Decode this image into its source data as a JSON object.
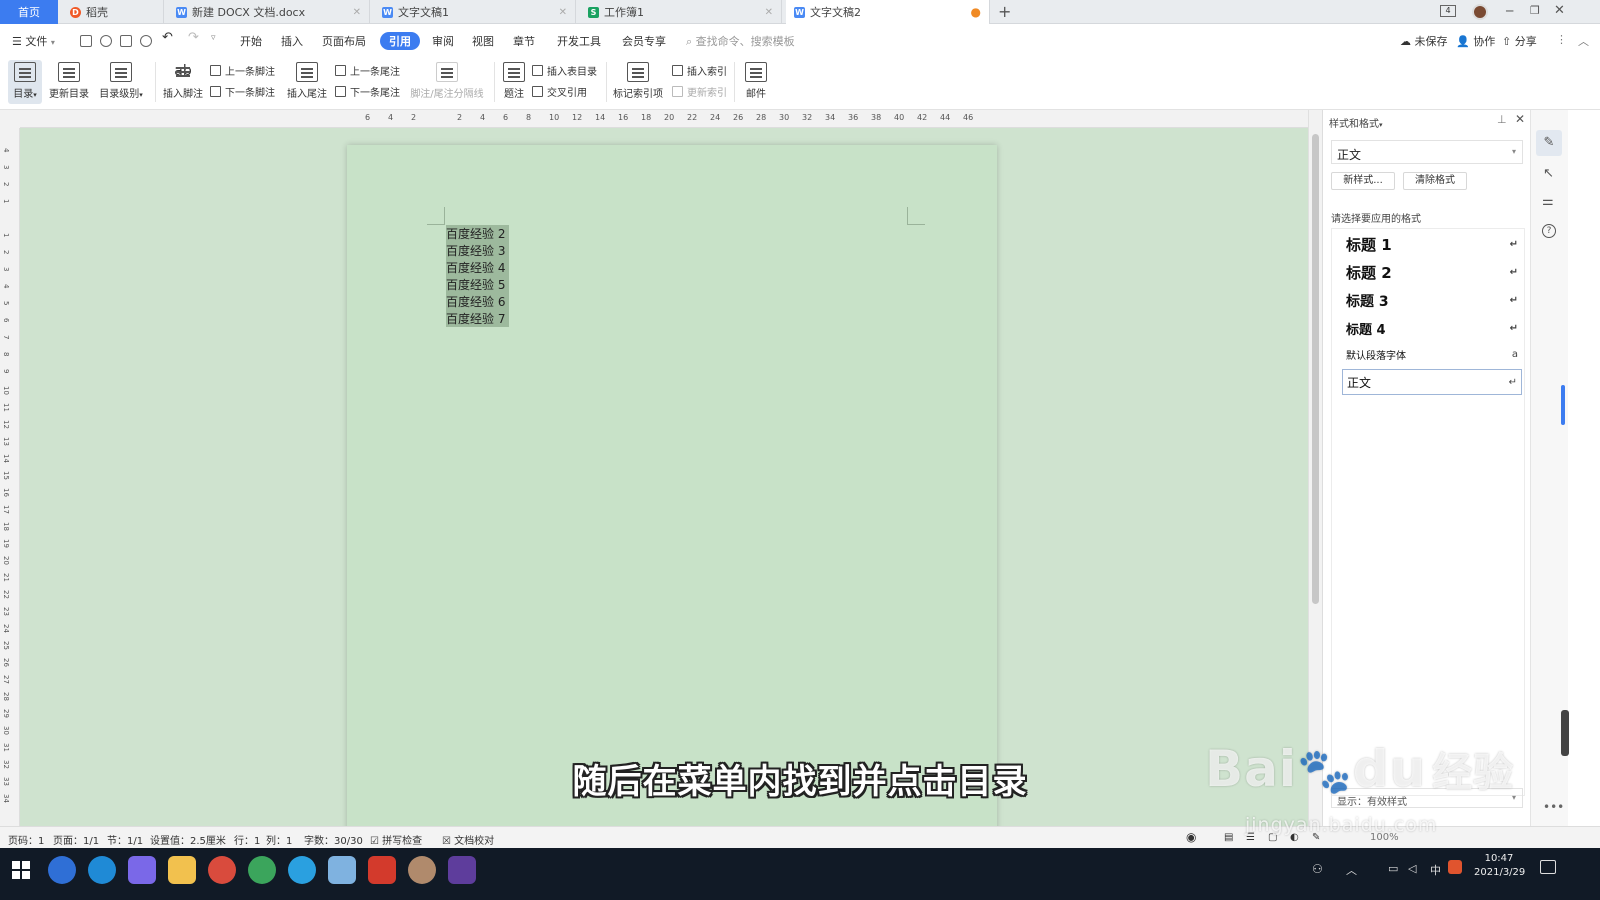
{
  "tabs": [
    {
      "label": "首页",
      "icon": "home-tab"
    },
    {
      "label": "稻壳",
      "icon": "docer-icon"
    },
    {
      "label": "新建 DOCX 文档.docx",
      "icon": "word-doc-icon"
    },
    {
      "label": "文字文稿1",
      "icon": "word-doc-icon"
    },
    {
      "label": "工作簿1",
      "icon": "sheet-icon"
    },
    {
      "label": "文字文稿2",
      "icon": "word-doc-icon"
    }
  ],
  "add_tab": "+",
  "window_badge": "4",
  "menu": {
    "file": "文件",
    "items": [
      "开始",
      "插入",
      "页面布局",
      "引用",
      "审阅",
      "视图",
      "章节",
      "开发工具",
      "会员专享"
    ],
    "active": "引用",
    "search_placeholder": "查找命令、搜索模板",
    "unsaved": "未保存",
    "collab": "协作",
    "share": "分享"
  },
  "ribbon": {
    "toc": "目录",
    "update_toc": "更新目录",
    "toc_level": "目录级别",
    "insert_footnote": "插入脚注",
    "prev_footnote": "上一条脚注",
    "next_footnote": "下一条脚注",
    "insert_endnote": "插入尾注",
    "prev_endnote": "上一条尾注",
    "next_endnote": "下一条尾注",
    "separator": "脚注/尾注分隔线",
    "caption": "题注",
    "insert_table_toc": "插入表目录",
    "cross_ref": "交叉引用",
    "mark_index": "标记索引项",
    "insert_index": "插入索引",
    "update_index": "更新索引",
    "mail": "邮件"
  },
  "ruler": {
    "h": [
      "6",
      "4",
      "2",
      "",
      "2",
      "4",
      "6",
      "8",
      "10",
      "12",
      "14",
      "16",
      "18",
      "20",
      "22",
      "24",
      "26",
      "28",
      "30",
      "32",
      "34",
      "36",
      "38",
      "40",
      "42",
      "44",
      "46"
    ],
    "v": [
      "4",
      "3",
      "2",
      "1",
      "",
      "1",
      "2",
      "3",
      "4",
      "5",
      "6",
      "7",
      "8",
      "9",
      "10",
      "11",
      "12",
      "13",
      "14",
      "15",
      "16",
      "17",
      "18",
      "19",
      "20",
      "21",
      "22",
      "23",
      "24",
      "25",
      "26",
      "27",
      "28",
      "29",
      "30",
      "31",
      "32",
      "33",
      "34"
    ]
  },
  "doc": {
    "lines": [
      "百度经验 2",
      "百度经验 3",
      "百度经验 4",
      "百度经验 5",
      "百度经验 6",
      "百度经验 7"
    ]
  },
  "panel": {
    "title": "样式和格式",
    "current_style": "正文",
    "new_style": "新样式...",
    "clear_format": "清除格式",
    "choose_label": "请选择要应用的格式",
    "styles": [
      {
        "name": "标题  1",
        "mark": "↵"
      },
      {
        "name": "标题  2",
        "mark": "↵"
      },
      {
        "name": "标题  3",
        "mark": "↵"
      },
      {
        "name": "标题 4",
        "mark": "↵"
      },
      {
        "name": "默认段落字体",
        "mark": "a"
      },
      {
        "name": "正文",
        "mark": "↵"
      }
    ],
    "show_label": "显示：有效样式"
  },
  "status": {
    "page_num": "页码：1",
    "pages": "页面：1/1",
    "section": "节：1/1",
    "setting": "设置值：2.5厘米",
    "row": "行：1",
    "col": "列：1",
    "words": "字数：30/30",
    "spell": "拼写检查",
    "proof": "文档校对",
    "zoom": "100%"
  },
  "taskbar": {
    "time": "10:47",
    "date": "2021/3/29",
    "ime": "中"
  },
  "subtitle": "随后在菜单内找到并点击目录",
  "watermark": {
    "brand": "Bai",
    "du": "du",
    "jy": "经验",
    "url": "jingyan.baidu.com"
  }
}
